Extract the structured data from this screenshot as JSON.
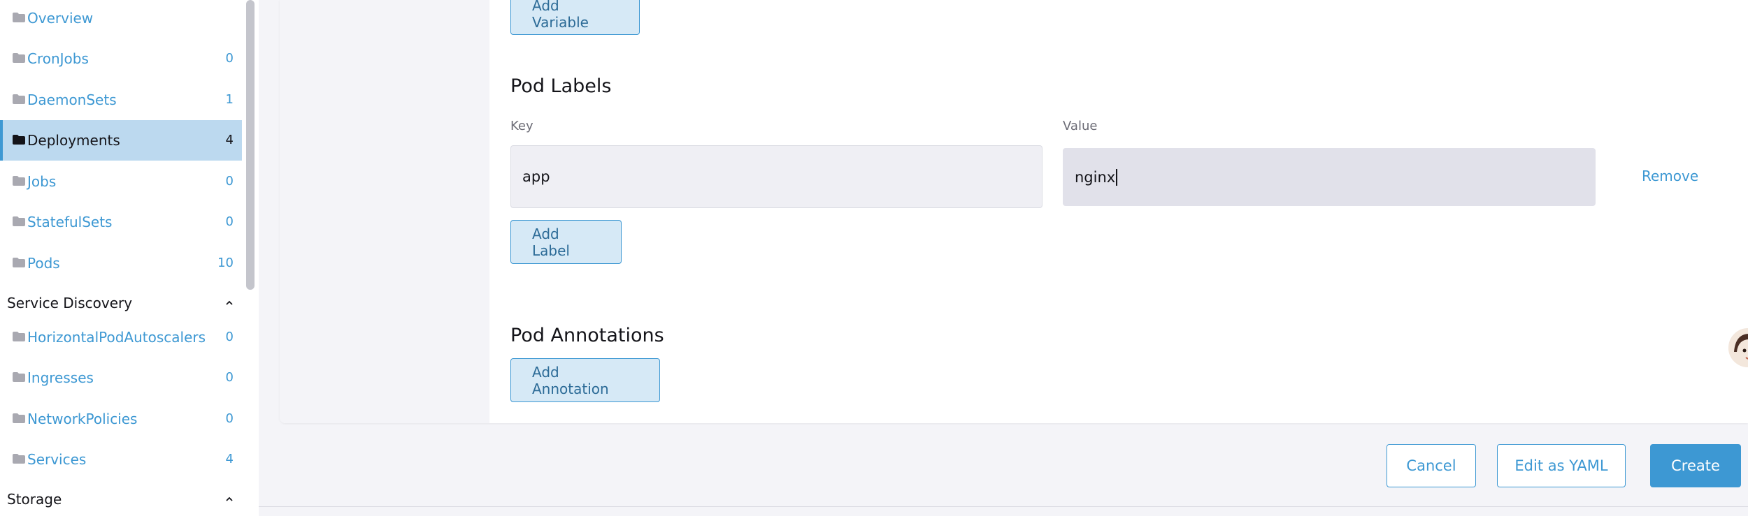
{
  "sidebar": {
    "items": [
      {
        "label": "Overview",
        "count": ""
      },
      {
        "label": "CronJobs",
        "count": "0"
      },
      {
        "label": "DaemonSets",
        "count": "1"
      },
      {
        "label": "Deployments",
        "count": "4"
      },
      {
        "label": "Jobs",
        "count": "0"
      },
      {
        "label": "StatefulSets",
        "count": "0"
      },
      {
        "label": "Pods",
        "count": "10"
      }
    ],
    "service_discovery": {
      "title": "Service Discovery",
      "items": [
        {
          "label": "HorizontalPodAutoscalers",
          "count": "0"
        },
        {
          "label": "Ingresses",
          "count": "0"
        },
        {
          "label": "NetworkPolicies",
          "count": "0"
        },
        {
          "label": "Services",
          "count": "4"
        }
      ]
    },
    "storage": {
      "title": "Storage"
    }
  },
  "form": {
    "add_variable_label": "Add Variable",
    "pod_labels": {
      "title": "Pod Labels",
      "key_label": "Key",
      "value_label": "Value",
      "key_value": "app",
      "value_value": "nginx",
      "remove_label": "Remove",
      "add_label": "Add Label"
    },
    "pod_annotations": {
      "title": "Pod Annotations",
      "add_annotation_label": "Add Annotation"
    }
  },
  "footer": {
    "cancel_label": "Cancel",
    "edit_yaml_label": "Edit as YAML",
    "create_label": "Create"
  },
  "colors": {
    "accent": "#3d98d3",
    "active_nav_bg": "#bcd9ef",
    "page_bg": "#f4f4f8"
  }
}
